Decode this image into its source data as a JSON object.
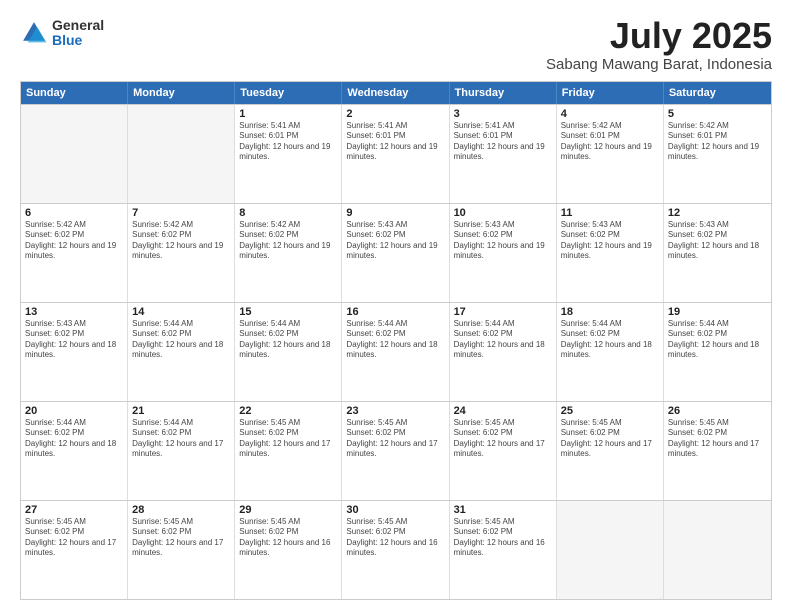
{
  "logo": {
    "general": "General",
    "blue": "Blue"
  },
  "title": "July 2025",
  "location": "Sabang Mawang Barat, Indonesia",
  "header_days": [
    "Sunday",
    "Monday",
    "Tuesday",
    "Wednesday",
    "Thursday",
    "Friday",
    "Saturday"
  ],
  "weeks": [
    [
      {
        "day": "",
        "sunrise": "",
        "sunset": "",
        "daylight": "",
        "empty": true
      },
      {
        "day": "",
        "sunrise": "",
        "sunset": "",
        "daylight": "",
        "empty": true
      },
      {
        "day": "1",
        "sunrise": "Sunrise: 5:41 AM",
        "sunset": "Sunset: 6:01 PM",
        "daylight": "Daylight: 12 hours and 19 minutes.",
        "empty": false
      },
      {
        "day": "2",
        "sunrise": "Sunrise: 5:41 AM",
        "sunset": "Sunset: 6:01 PM",
        "daylight": "Daylight: 12 hours and 19 minutes.",
        "empty": false
      },
      {
        "day": "3",
        "sunrise": "Sunrise: 5:41 AM",
        "sunset": "Sunset: 6:01 PM",
        "daylight": "Daylight: 12 hours and 19 minutes.",
        "empty": false
      },
      {
        "day": "4",
        "sunrise": "Sunrise: 5:42 AM",
        "sunset": "Sunset: 6:01 PM",
        "daylight": "Daylight: 12 hours and 19 minutes.",
        "empty": false
      },
      {
        "day": "5",
        "sunrise": "Sunrise: 5:42 AM",
        "sunset": "Sunset: 6:01 PM",
        "daylight": "Daylight: 12 hours and 19 minutes.",
        "empty": false
      }
    ],
    [
      {
        "day": "6",
        "sunrise": "Sunrise: 5:42 AM",
        "sunset": "Sunset: 6:02 PM",
        "daylight": "Daylight: 12 hours and 19 minutes.",
        "empty": false
      },
      {
        "day": "7",
        "sunrise": "Sunrise: 5:42 AM",
        "sunset": "Sunset: 6:02 PM",
        "daylight": "Daylight: 12 hours and 19 minutes.",
        "empty": false
      },
      {
        "day": "8",
        "sunrise": "Sunrise: 5:42 AM",
        "sunset": "Sunset: 6:02 PM",
        "daylight": "Daylight: 12 hours and 19 minutes.",
        "empty": false
      },
      {
        "day": "9",
        "sunrise": "Sunrise: 5:43 AM",
        "sunset": "Sunset: 6:02 PM",
        "daylight": "Daylight: 12 hours and 19 minutes.",
        "empty": false
      },
      {
        "day": "10",
        "sunrise": "Sunrise: 5:43 AM",
        "sunset": "Sunset: 6:02 PM",
        "daylight": "Daylight: 12 hours and 19 minutes.",
        "empty": false
      },
      {
        "day": "11",
        "sunrise": "Sunrise: 5:43 AM",
        "sunset": "Sunset: 6:02 PM",
        "daylight": "Daylight: 12 hours and 19 minutes.",
        "empty": false
      },
      {
        "day": "12",
        "sunrise": "Sunrise: 5:43 AM",
        "sunset": "Sunset: 6:02 PM",
        "daylight": "Daylight: 12 hours and 18 minutes.",
        "empty": false
      }
    ],
    [
      {
        "day": "13",
        "sunrise": "Sunrise: 5:43 AM",
        "sunset": "Sunset: 6:02 PM",
        "daylight": "Daylight: 12 hours and 18 minutes.",
        "empty": false
      },
      {
        "day": "14",
        "sunrise": "Sunrise: 5:44 AM",
        "sunset": "Sunset: 6:02 PM",
        "daylight": "Daylight: 12 hours and 18 minutes.",
        "empty": false
      },
      {
        "day": "15",
        "sunrise": "Sunrise: 5:44 AM",
        "sunset": "Sunset: 6:02 PM",
        "daylight": "Daylight: 12 hours and 18 minutes.",
        "empty": false
      },
      {
        "day": "16",
        "sunrise": "Sunrise: 5:44 AM",
        "sunset": "Sunset: 6:02 PM",
        "daylight": "Daylight: 12 hours and 18 minutes.",
        "empty": false
      },
      {
        "day": "17",
        "sunrise": "Sunrise: 5:44 AM",
        "sunset": "Sunset: 6:02 PM",
        "daylight": "Daylight: 12 hours and 18 minutes.",
        "empty": false
      },
      {
        "day": "18",
        "sunrise": "Sunrise: 5:44 AM",
        "sunset": "Sunset: 6:02 PM",
        "daylight": "Daylight: 12 hours and 18 minutes.",
        "empty": false
      },
      {
        "day": "19",
        "sunrise": "Sunrise: 5:44 AM",
        "sunset": "Sunset: 6:02 PM",
        "daylight": "Daylight: 12 hours and 18 minutes.",
        "empty": false
      }
    ],
    [
      {
        "day": "20",
        "sunrise": "Sunrise: 5:44 AM",
        "sunset": "Sunset: 6:02 PM",
        "daylight": "Daylight: 12 hours and 18 minutes.",
        "empty": false
      },
      {
        "day": "21",
        "sunrise": "Sunrise: 5:44 AM",
        "sunset": "Sunset: 6:02 PM",
        "daylight": "Daylight: 12 hours and 17 minutes.",
        "empty": false
      },
      {
        "day": "22",
        "sunrise": "Sunrise: 5:45 AM",
        "sunset": "Sunset: 6:02 PM",
        "daylight": "Daylight: 12 hours and 17 minutes.",
        "empty": false
      },
      {
        "day": "23",
        "sunrise": "Sunrise: 5:45 AM",
        "sunset": "Sunset: 6:02 PM",
        "daylight": "Daylight: 12 hours and 17 minutes.",
        "empty": false
      },
      {
        "day": "24",
        "sunrise": "Sunrise: 5:45 AM",
        "sunset": "Sunset: 6:02 PM",
        "daylight": "Daylight: 12 hours and 17 minutes.",
        "empty": false
      },
      {
        "day": "25",
        "sunrise": "Sunrise: 5:45 AM",
        "sunset": "Sunset: 6:02 PM",
        "daylight": "Daylight: 12 hours and 17 minutes.",
        "empty": false
      },
      {
        "day": "26",
        "sunrise": "Sunrise: 5:45 AM",
        "sunset": "Sunset: 6:02 PM",
        "daylight": "Daylight: 12 hours and 17 minutes.",
        "empty": false
      }
    ],
    [
      {
        "day": "27",
        "sunrise": "Sunrise: 5:45 AM",
        "sunset": "Sunset: 6:02 PM",
        "daylight": "Daylight: 12 hours and 17 minutes.",
        "empty": false
      },
      {
        "day": "28",
        "sunrise": "Sunrise: 5:45 AM",
        "sunset": "Sunset: 6:02 PM",
        "daylight": "Daylight: 12 hours and 17 minutes.",
        "empty": false
      },
      {
        "day": "29",
        "sunrise": "Sunrise: 5:45 AM",
        "sunset": "Sunset: 6:02 PM",
        "daylight": "Daylight: 12 hours and 16 minutes.",
        "empty": false
      },
      {
        "day": "30",
        "sunrise": "Sunrise: 5:45 AM",
        "sunset": "Sunset: 6:02 PM",
        "daylight": "Daylight: 12 hours and 16 minutes.",
        "empty": false
      },
      {
        "day": "31",
        "sunrise": "Sunrise: 5:45 AM",
        "sunset": "Sunset: 6:02 PM",
        "daylight": "Daylight: 12 hours and 16 minutes.",
        "empty": false
      },
      {
        "day": "",
        "sunrise": "",
        "sunset": "",
        "daylight": "",
        "empty": true
      },
      {
        "day": "",
        "sunrise": "",
        "sunset": "",
        "daylight": "",
        "empty": true
      }
    ]
  ]
}
